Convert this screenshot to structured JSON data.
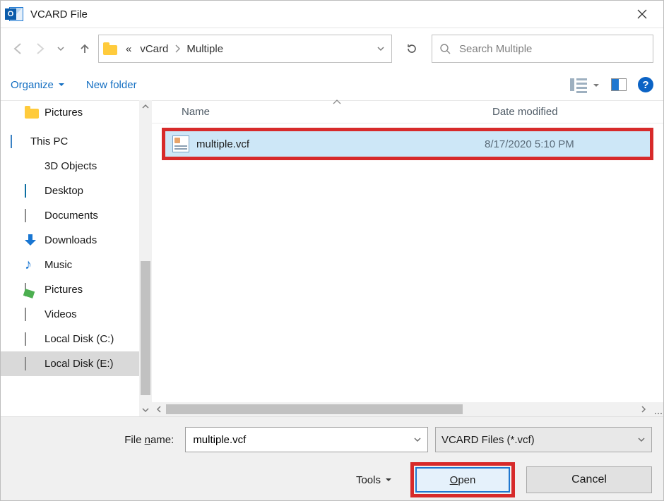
{
  "window": {
    "title": "VCARD File",
    "app_icon_letter": "O"
  },
  "nav": {
    "back_enabled": false,
    "forward_enabled": false
  },
  "breadcrumbs": {
    "prefix": "«",
    "items": [
      "vCard",
      "Multiple"
    ]
  },
  "search": {
    "placeholder": "Search Multiple",
    "value": ""
  },
  "toolbar": {
    "organize": "Organize",
    "new_folder": "New folder"
  },
  "sidebar": {
    "items": [
      {
        "label": "Pictures",
        "icon": "folder"
      },
      {
        "label": "This PC",
        "icon": "pc",
        "root": true
      },
      {
        "label": "3D Objects",
        "icon": "3d"
      },
      {
        "label": "Desktop",
        "icon": "desktop"
      },
      {
        "label": "Documents",
        "icon": "docs"
      },
      {
        "label": "Downloads",
        "icon": "down"
      },
      {
        "label": "Music",
        "icon": "music"
      },
      {
        "label": "Pictures",
        "icon": "pictures2"
      },
      {
        "label": "Videos",
        "icon": "videos"
      },
      {
        "label": "Local Disk (C:)",
        "icon": "disk"
      },
      {
        "label": "Local Disk (E:)",
        "icon": "disk",
        "selected": true
      }
    ]
  },
  "columns": {
    "name": "Name",
    "date": "Date modified"
  },
  "files": [
    {
      "name": "multiple.vcf",
      "date": "8/17/2020 5:10 PM"
    }
  ],
  "footer": {
    "filename_label_pre": "File ",
    "filename_label_ul": "n",
    "filename_label_post": "ame:",
    "filename_value": "multiple.vcf",
    "type_filter": "VCARD Files (*.vcf)",
    "tools": "Tools",
    "open_ul": "O",
    "open_post": "pen",
    "cancel": "Cancel"
  }
}
